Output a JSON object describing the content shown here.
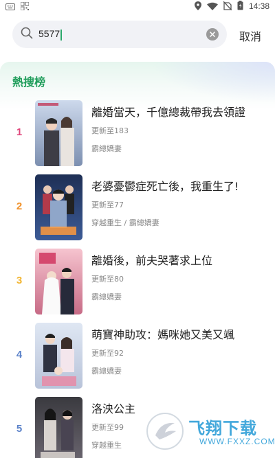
{
  "status_bar": {
    "time": "14:38",
    "left_icons": [
      "keyboard-icon",
      "qr-scan-icon"
    ],
    "right_icons": [
      "location-icon",
      "wifi-icon",
      "no-sim-icon",
      "battery-icon"
    ]
  },
  "search": {
    "query": "5577",
    "cancel_label": "取消"
  },
  "hot_list": {
    "title": "熱搜榜",
    "items": [
      {
        "rank": "1",
        "rank_color": "#e0457b",
        "title": "離婚當天，千億總裁帶我去領證",
        "update": "更新至183",
        "genre": "霸總嬌妻"
      },
      {
        "rank": "2",
        "rank_color": "#f0912a",
        "title": "老婆憂鬱症死亡後，我重生了!",
        "update": "更新至77",
        "genre": "穿越重生 / 霸總嬌妻"
      },
      {
        "rank": "3",
        "rank_color": "#f2b531",
        "title": "離婚後，前夫哭著求上位",
        "update": "更新至80",
        "genre": "霸總嬌妻"
      },
      {
        "rank": "4",
        "rank_color": "#5b82c9",
        "title": "萌寶神助攻：媽咪她又美又颯",
        "update": "更新至92",
        "genre": "霸總嬌妻"
      },
      {
        "rank": "5",
        "rank_color": "#5b82c9",
        "title": "洛泱公主",
        "update": "更新至99",
        "genre": "穿越重生"
      }
    ]
  },
  "watermark": {
    "brand": "飞翔下载",
    "url": "WWW.FXXZ.COM"
  }
}
